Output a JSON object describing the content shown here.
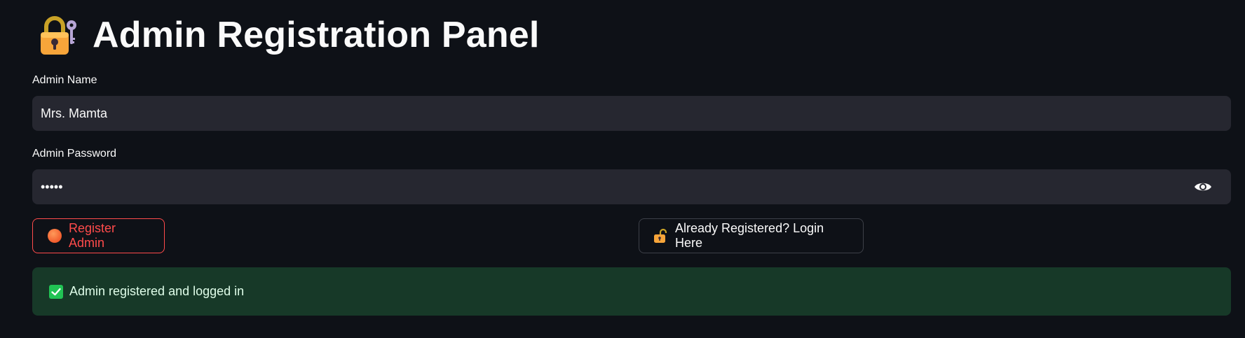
{
  "header": {
    "title": "Admin Registration Panel",
    "icon": "lock-with-key-icon"
  },
  "form": {
    "name_field": {
      "label": "Admin Name",
      "value": "Mrs. Mamta"
    },
    "password_field": {
      "label": "Admin Password",
      "masked_value": "•••••",
      "toggle_icon": "eye-icon"
    }
  },
  "buttons": {
    "register": {
      "label": "Register Admin",
      "icon": "orange-circle-icon"
    },
    "login": {
      "label": "Already Registered? Login Here",
      "icon": "unlocked-padlock-icon"
    }
  },
  "status": {
    "message": "Admin registered and logged in",
    "icon": "check-mark-icon"
  },
  "colors": {
    "background": "#0e1117",
    "input_bg": "#262730",
    "primary_accent": "#ff4b4b",
    "success_bg": "#173928",
    "success_check": "#21c354"
  }
}
